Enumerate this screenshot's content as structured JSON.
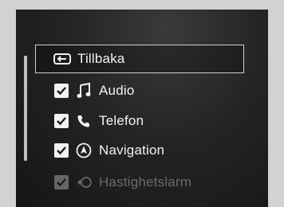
{
  "menu": {
    "back": {
      "label": "Tillbaka",
      "icon": "back-return-icon"
    },
    "items": [
      {
        "label": "Audio",
        "checked": true,
        "icon": "music-note-icon"
      },
      {
        "label": "Telefon",
        "checked": true,
        "icon": "phone-icon"
      },
      {
        "label": "Navigation",
        "checked": true,
        "icon": "navigation-arrow-icon"
      },
      {
        "label": "Hastighetslarm",
        "checked": true,
        "icon": "speed-alarm-icon"
      }
    ]
  },
  "colors": {
    "screen_bg": "#242424",
    "text": "#f2f2f2",
    "outer_frame": "#d2d2d2"
  }
}
